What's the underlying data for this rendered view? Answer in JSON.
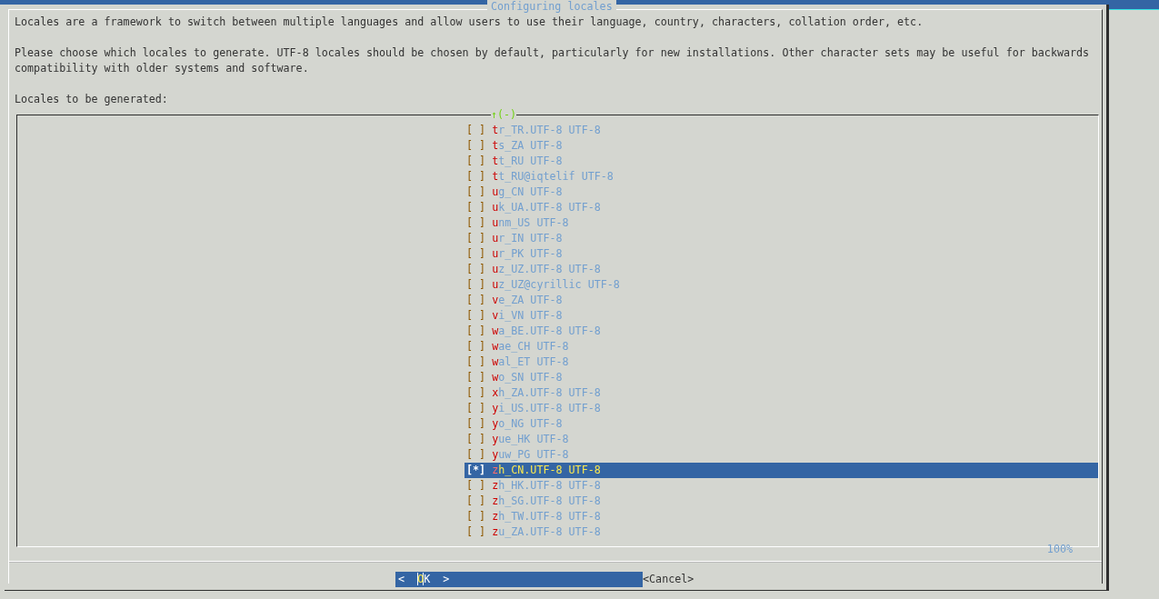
{
  "dialog": {
    "title": "Configuring locales",
    "paragraphs": [
      "Locales are a framework to switch between multiple languages and allow users to use their language, country, characters, collation order, etc.",
      "Please choose which locales to generate. UTF-8 locales should be chosen by default, particularly for new installations. Other character sets may be useful for backwards compatibility with older systems and software."
    ],
    "list_label": "Locales to be generated:",
    "scroll_indicator": "↑(-)",
    "items": [
      {
        "box": "[ ]",
        "label": "tr_TR.UTF-8 UTF-8",
        "checked": false,
        "selected": false
      },
      {
        "box": "[ ]",
        "label": "ts_ZA UTF-8",
        "checked": false,
        "selected": false
      },
      {
        "box": "[ ]",
        "label": "tt_RU UTF-8",
        "checked": false,
        "selected": false
      },
      {
        "box": "[ ]",
        "label": "tt_RU@iqtelif UTF-8",
        "checked": false,
        "selected": false
      },
      {
        "box": "[ ]",
        "label": "ug_CN UTF-8",
        "checked": false,
        "selected": false
      },
      {
        "box": "[ ]",
        "label": "uk_UA.UTF-8 UTF-8",
        "checked": false,
        "selected": false
      },
      {
        "box": "[ ]",
        "label": "unm_US UTF-8",
        "checked": false,
        "selected": false
      },
      {
        "box": "[ ]",
        "label": "ur_IN UTF-8",
        "checked": false,
        "selected": false
      },
      {
        "box": "[ ]",
        "label": "ur_PK UTF-8",
        "checked": false,
        "selected": false
      },
      {
        "box": "[ ]",
        "label": "uz_UZ.UTF-8 UTF-8",
        "checked": false,
        "selected": false
      },
      {
        "box": "[ ]",
        "label": "uz_UZ@cyrillic UTF-8",
        "checked": false,
        "selected": false
      },
      {
        "box": "[ ]",
        "label": "ve_ZA UTF-8",
        "checked": false,
        "selected": false
      },
      {
        "box": "[ ]",
        "label": "vi_VN UTF-8",
        "checked": false,
        "selected": false
      },
      {
        "box": "[ ]",
        "label": "wa_BE.UTF-8 UTF-8",
        "checked": false,
        "selected": false
      },
      {
        "box": "[ ]",
        "label": "wae_CH UTF-8",
        "checked": false,
        "selected": false
      },
      {
        "box": "[ ]",
        "label": "wal_ET UTF-8",
        "checked": false,
        "selected": false
      },
      {
        "box": "[ ]",
        "label": "wo_SN UTF-8",
        "checked": false,
        "selected": false
      },
      {
        "box": "[ ]",
        "label": "xh_ZA.UTF-8 UTF-8",
        "checked": false,
        "selected": false
      },
      {
        "box": "[ ]",
        "label": "yi_US.UTF-8 UTF-8",
        "checked": false,
        "selected": false
      },
      {
        "box": "[ ]",
        "label": "yo_NG UTF-8",
        "checked": false,
        "selected": false
      },
      {
        "box": "[ ]",
        "label": "yue_HK UTF-8",
        "checked": false,
        "selected": false
      },
      {
        "box": "[ ]",
        "label": "yuw_PG UTF-8",
        "checked": false,
        "selected": false
      },
      {
        "box": "[*]",
        "label": "zh_CN.UTF-8 UTF-8",
        "checked": true,
        "selected": true
      },
      {
        "box": "[ ]",
        "label": "zh_HK.UTF-8 UTF-8",
        "checked": false,
        "selected": false
      },
      {
        "box": "[ ]",
        "label": "zh_SG.UTF-8 UTF-8",
        "checked": false,
        "selected": false
      },
      {
        "box": "[ ]",
        "label": "zh_TW.UTF-8 UTF-8",
        "checked": false,
        "selected": false
      },
      {
        "box": "[ ]",
        "label": "zu_ZA.UTF-8 UTF-8",
        "checked": false,
        "selected": false
      }
    ],
    "scroll_percent": "100%",
    "buttons": [
      {
        "label": "<  OK  >",
        "selected": true
      },
      {
        "label": "<Cancel>",
        "selected": false
      }
    ]
  }
}
